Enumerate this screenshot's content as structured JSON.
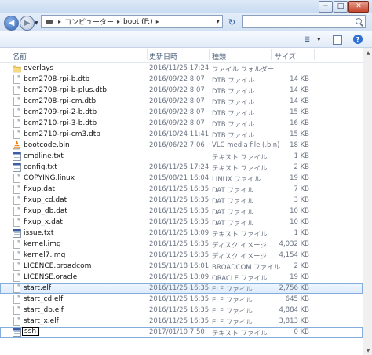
{
  "window": {
    "minimize_glyph": "─",
    "maximize_glyph": "□",
    "close_glyph": "✕"
  },
  "addressbar": {
    "path": [
      "コンピューター",
      "boot (F:)"
    ],
    "separator": "▸",
    "search_placeholder": "",
    "refresh_glyph": "↻"
  },
  "toolbar": {
    "views_glyph": "≣",
    "help_glyph": "?"
  },
  "columns": {
    "name": "名前",
    "date": "更新日時",
    "type": "種類",
    "size": "サイズ"
  },
  "files": [
    {
      "name": "overlays",
      "date": "2016/11/25 17:24",
      "type": "ファイル フォルダー",
      "size": "",
      "icon": "folder-icon"
    },
    {
      "name": "bcm2708-rpi-b.dtb",
      "date": "2016/09/22 8:07",
      "type": "DTB ファイル",
      "size": "14 KB",
      "icon": "file-icon"
    },
    {
      "name": "bcm2708-rpi-b-plus.dtb",
      "date": "2016/09/22 8:07",
      "type": "DTB ファイル",
      "size": "14 KB",
      "icon": "file-icon"
    },
    {
      "name": "bcm2708-rpi-cm.dtb",
      "date": "2016/09/22 8:07",
      "type": "DTB ファイル",
      "size": "14 KB",
      "icon": "file-icon"
    },
    {
      "name": "bcm2709-rpi-2-b.dtb",
      "date": "2016/09/22 8:07",
      "type": "DTB ファイル",
      "size": "15 KB",
      "icon": "file-icon"
    },
    {
      "name": "bcm2710-rpi-3-b.dtb",
      "date": "2016/09/22 8:07",
      "type": "DTB ファイル",
      "size": "16 KB",
      "icon": "file-icon"
    },
    {
      "name": "bcm2710-rpi-cm3.dtb",
      "date": "2016/10/24 11:41",
      "type": "DTB ファイル",
      "size": "15 KB",
      "icon": "file-icon"
    },
    {
      "name": "bootcode.bin",
      "date": "2016/06/22 7:06",
      "type": "VLC media file (.bin)",
      "size": "18 KB",
      "icon": "vlc-icon"
    },
    {
      "name": "cmdline.txt",
      "date": "",
      "type": "テキスト ファイル",
      "size": "1 KB",
      "icon": "text-file-icon"
    },
    {
      "name": "config.txt",
      "date": "2016/11/25 17:24",
      "type": "テキスト ファイル",
      "size": "2 KB",
      "icon": "text-file-icon"
    },
    {
      "name": "COPYING.linux",
      "date": "2015/08/21 16:04",
      "type": "LINUX ファイル",
      "size": "19 KB",
      "icon": "file-icon"
    },
    {
      "name": "fixup.dat",
      "date": "2016/11/25 16:35",
      "type": "DAT ファイル",
      "size": "7 KB",
      "icon": "file-icon"
    },
    {
      "name": "fixup_cd.dat",
      "date": "2016/11/25 16:35",
      "type": "DAT ファイル",
      "size": "3 KB",
      "icon": "file-icon"
    },
    {
      "name": "fixup_db.dat",
      "date": "2016/11/25 16:35",
      "type": "DAT ファイル",
      "size": "10 KB",
      "icon": "file-icon"
    },
    {
      "name": "fixup_x.dat",
      "date": "2016/11/25 16:35",
      "type": "DAT ファイル",
      "size": "10 KB",
      "icon": "file-icon"
    },
    {
      "name": "issue.txt",
      "date": "2016/11/25 18:09",
      "type": "テキスト ファイル",
      "size": "1 KB",
      "icon": "text-file-icon"
    },
    {
      "name": "kernel.img",
      "date": "2016/11/25 16:35",
      "type": "ディスク イメージ ...",
      "size": "4,032 KB",
      "icon": "file-icon"
    },
    {
      "name": "kernel7.img",
      "date": "2016/11/25 16:35",
      "type": "ディスク イメージ ...",
      "size": "4,154 KB",
      "icon": "file-icon"
    },
    {
      "name": "LICENCE.broadcom",
      "date": "2015/11/18 16:01",
      "type": "BROADCOM ファイル",
      "size": "2 KB",
      "icon": "file-icon"
    },
    {
      "name": "LICENSE.oracle",
      "date": "2016/11/25 18:09",
      "type": "ORACLE ファイル",
      "size": "19 KB",
      "icon": "file-icon"
    },
    {
      "name": "start.elf",
      "date": "2016/11/25 16:35",
      "type": "ELF ファイル",
      "size": "2,756 KB",
      "icon": "file-icon",
      "selected": true
    },
    {
      "name": "start_cd.elf",
      "date": "2016/11/25 16:35",
      "type": "ELF ファイル",
      "size": "645 KB",
      "icon": "file-icon"
    },
    {
      "name": "start_db.elf",
      "date": "2016/11/25 16:35",
      "type": "ELF ファイル",
      "size": "4,884 KB",
      "icon": "file-icon"
    },
    {
      "name": "start_x.elf",
      "date": "2016/11/25 16:35",
      "type": "ELF ファイル",
      "size": "3,813 KB",
      "icon": "file-icon"
    },
    {
      "name": "ssh",
      "date": "2017/01/10 7:50",
      "type": "テキスト ファイル",
      "size": "0 KB",
      "icon": "text-file-icon",
      "editing": true
    }
  ]
}
